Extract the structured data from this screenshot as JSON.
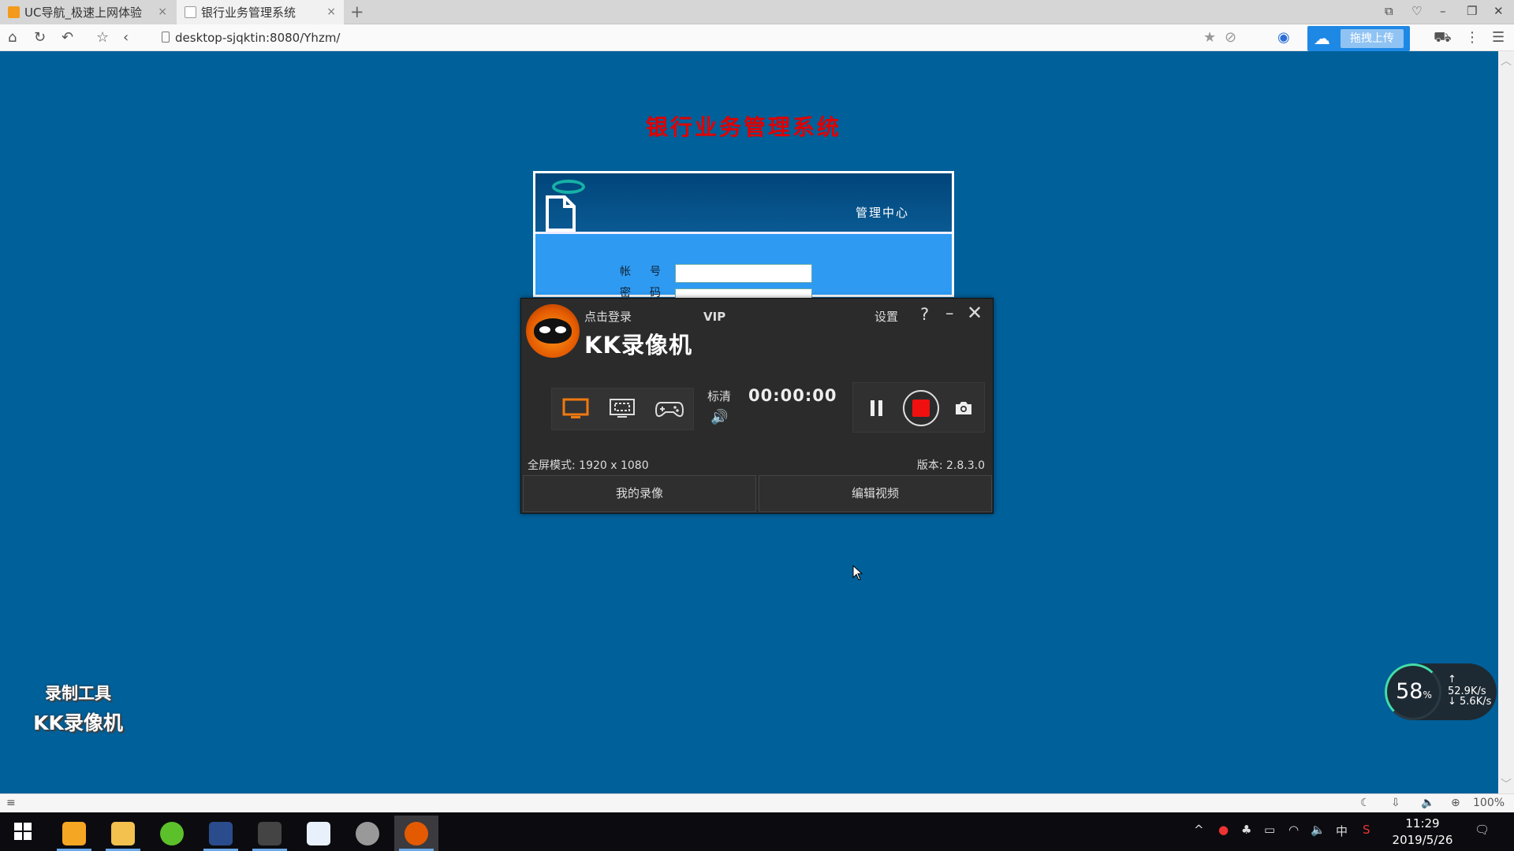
{
  "browser": {
    "tabs": [
      {
        "label": "UC导航_极速上网体验",
        "close": "×"
      },
      {
        "label": "银行业务管理系统",
        "close": "×"
      }
    ],
    "new_tab": "+",
    "url": "desktop-sjqktin:8080/Yhzm/",
    "upload_label": "拖拽上传"
  },
  "page": {
    "title": "银行业务管理系统",
    "login": {
      "header": "管理中心",
      "account_label": "帐号:",
      "password_label": "密码:"
    }
  },
  "recorder": {
    "login_link": "点击登录",
    "vip": "VIP",
    "brand": "KK录像机",
    "settings": "设置",
    "help": "?",
    "minimize": "–",
    "close": "✕",
    "quality": "标清",
    "timer": "00:00:00",
    "resolution": "全屏模式: 1920 x 1080",
    "version": "版本: 2.8.3.0",
    "my_recordings": "我的录像",
    "edit_video": "编辑视频"
  },
  "watermark": {
    "line1": "录制工具",
    "line2": "KK录像机"
  },
  "net_widget": {
    "percent": "58",
    "percent_unit": "%",
    "upload": "↑ 52.9K/s",
    "download": "↓ 5.6K/s"
  },
  "status_bar": {
    "zoom": "100%"
  },
  "taskbar": {
    "time": "11:29",
    "date": "2019/5/26",
    "ime": "中"
  },
  "colors": {
    "page_bg": "#00609a",
    "title_red": "#e00000",
    "record_red": "#f01010",
    "accent_orange": "#e45a00"
  }
}
